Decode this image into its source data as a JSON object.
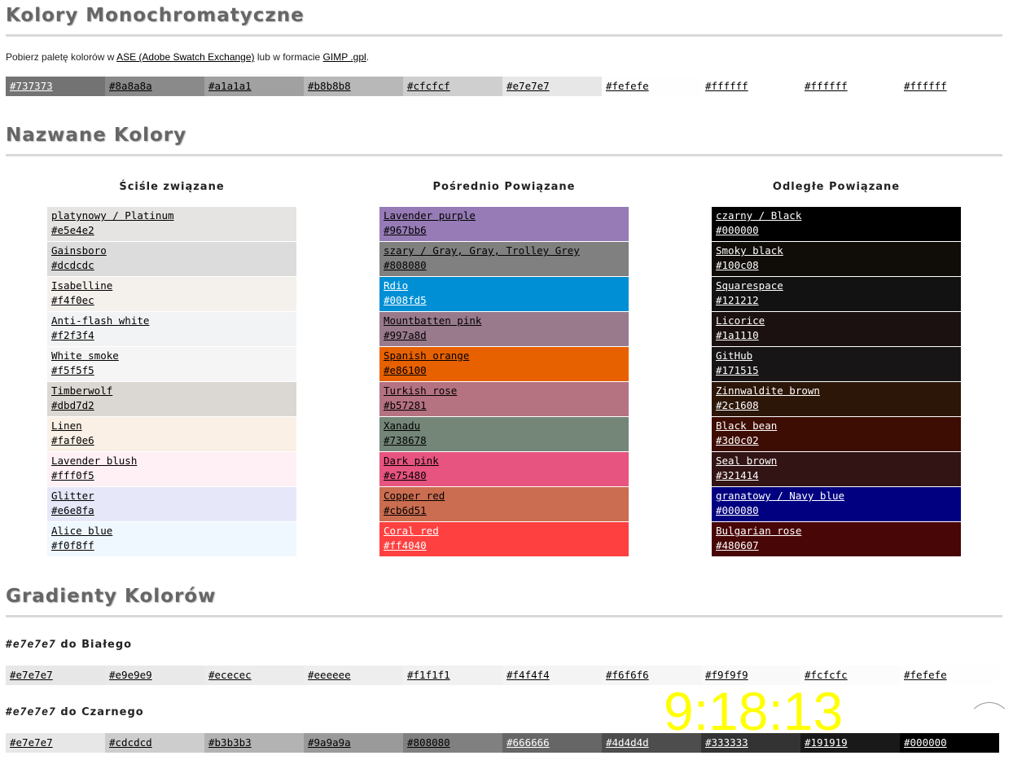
{
  "mono": {
    "title": "Kolory Monochromatyczne",
    "intro_prefix": "Pobierz paletę kolorów w ",
    "ase_link": "ASE (Adobe Swatch Exchange)",
    "intro_mid": " lub w formacie ",
    "gimp_link": "GIMP .gpl",
    "intro_suffix": ".",
    "swatches": [
      {
        "label": "#737373",
        "bg": "#737373",
        "fg": "#ffffff"
      },
      {
        "label": "#8a8a8a",
        "bg": "#8a8a8a",
        "fg": "#000000"
      },
      {
        "label": "#a1a1a1",
        "bg": "#a1a1a1",
        "fg": "#000000"
      },
      {
        "label": "#b8b8b8",
        "bg": "#b8b8b8",
        "fg": "#000000"
      },
      {
        "label": "#cfcfcf",
        "bg": "#cfcfcf",
        "fg": "#000000"
      },
      {
        "label": "#e7e7e7",
        "bg": "#e7e7e7",
        "fg": "#000000"
      },
      {
        "label": "#fefefe",
        "bg": "#fefefe",
        "fg": "#000000"
      },
      {
        "label": "#ffffff",
        "bg": "#ffffff",
        "fg": "#000000"
      },
      {
        "label": "#ffffff",
        "bg": "#ffffff",
        "fg": "#000000"
      },
      {
        "label": "#ffffff",
        "bg": "#ffffff",
        "fg": "#000000"
      }
    ]
  },
  "named": {
    "title": "Nazwane Kolory",
    "columns": [
      {
        "title": "Ściśle związane",
        "items": [
          {
            "name": "platynowy / Platinum",
            "hex": "#e5e4e2",
            "bg": "#e5e4e2",
            "fg": "#000000"
          },
          {
            "name": "Gainsboro",
            "hex": "#dcdcdc",
            "bg": "#dcdcdc",
            "fg": "#000000"
          },
          {
            "name": "Isabelline",
            "hex": "#f4f0ec",
            "bg": "#f4f0ec",
            "fg": "#000000"
          },
          {
            "name": "Anti-flash white",
            "hex": "#f2f3f4",
            "bg": "#f2f3f4",
            "fg": "#000000"
          },
          {
            "name": "White smoke",
            "hex": "#f5f5f5",
            "bg": "#f5f5f5",
            "fg": "#000000"
          },
          {
            "name": "Timberwolf",
            "hex": "#dbd7d2",
            "bg": "#dbd7d2",
            "fg": "#000000"
          },
          {
            "name": "Linen",
            "hex": "#faf0e6",
            "bg": "#faf0e6",
            "fg": "#000000"
          },
          {
            "name": "Lavender blush",
            "hex": "#fff0f5",
            "bg": "#fff0f5",
            "fg": "#000000"
          },
          {
            "name": "Glitter",
            "hex": "#e6e8fa",
            "bg": "#e6e8fa",
            "fg": "#000000"
          },
          {
            "name": "Alice blue",
            "hex": "#f0f8ff",
            "bg": "#f0f8ff",
            "fg": "#000000"
          }
        ]
      },
      {
        "title": "Pośrednio Powiązane",
        "items": [
          {
            "name": "Lavender purple",
            "hex": "#967bb6",
            "bg": "#967bb6",
            "fg": "#000000"
          },
          {
            "name": "szary / Gray, Gray, Trolley Grey",
            "hex": "#808080",
            "bg": "#808080",
            "fg": "#000000"
          },
          {
            "name": "Rdio",
            "hex": "#008fd5",
            "bg": "#008fd5",
            "fg": "#ffffff"
          },
          {
            "name": "Mountbatten pink",
            "hex": "#997a8d",
            "bg": "#997a8d",
            "fg": "#000000"
          },
          {
            "name": "Spanish orange",
            "hex": "#e86100",
            "bg": "#e86100",
            "fg": "#000000"
          },
          {
            "name": "Turkish rose",
            "hex": "#b57281",
            "bg": "#b57281",
            "fg": "#000000"
          },
          {
            "name": "Xanadu",
            "hex": "#738678",
            "bg": "#738678",
            "fg": "#000000"
          },
          {
            "name": "Dark pink",
            "hex": "#e75480",
            "bg": "#e75480",
            "fg": "#000000"
          },
          {
            "name": "Copper red",
            "hex": "#cb6d51",
            "bg": "#cb6d51",
            "fg": "#000000"
          },
          {
            "name": "Coral red",
            "hex": "#ff4040",
            "bg": "#ff4040",
            "fg": "#ffffff"
          }
        ]
      },
      {
        "title": "Odległe Powiązane",
        "items": [
          {
            "name": "czarny / Black",
            "hex": "#000000",
            "bg": "#000000",
            "fg": "#ffffff"
          },
          {
            "name": "Smoky black",
            "hex": "#100c08",
            "bg": "#100c08",
            "fg": "#ffffff"
          },
          {
            "name": "Squarespace",
            "hex": "#121212",
            "bg": "#121212",
            "fg": "#ffffff"
          },
          {
            "name": "Licorice",
            "hex": "#1a1110",
            "bg": "#1a1110",
            "fg": "#ffffff"
          },
          {
            "name": "GitHub",
            "hex": "#171515",
            "bg": "#171515",
            "fg": "#ffffff"
          },
          {
            "name": "Zinnwaldite brown",
            "hex": "#2c1608",
            "bg": "#2c1608",
            "fg": "#ffffff"
          },
          {
            "name": "Black bean",
            "hex": "#3d0c02",
            "bg": "#3d0c02",
            "fg": "#ffffff"
          },
          {
            "name": "Seal brown",
            "hex": "#321414",
            "bg": "#321414",
            "fg": "#ffffff"
          },
          {
            "name": "granatowy / Navy blue",
            "hex": "#000080",
            "bg": "#000080",
            "fg": "#ffffff"
          },
          {
            "name": "Bulgarian rose",
            "hex": "#480607",
            "bg": "#480607",
            "fg": "#ffffff"
          }
        ]
      }
    ]
  },
  "gradients": {
    "title": "Gradienty Kolorów",
    "to_white": {
      "hex": "#e7e7e7",
      "text": " do Białego",
      "swatches": [
        {
          "label": "#e7e7e7",
          "bg": "#e7e7e7",
          "fg": "#000000"
        },
        {
          "label": "#e9e9e9",
          "bg": "#e9e9e9",
          "fg": "#000000"
        },
        {
          "label": "#ececec",
          "bg": "#ececec",
          "fg": "#000000"
        },
        {
          "label": "#eeeeee",
          "bg": "#eeeeee",
          "fg": "#000000"
        },
        {
          "label": "#f1f1f1",
          "bg": "#f1f1f1",
          "fg": "#000000"
        },
        {
          "label": "#f4f4f4",
          "bg": "#f4f4f4",
          "fg": "#000000"
        },
        {
          "label": "#f6f6f6",
          "bg": "#f6f6f6",
          "fg": "#000000"
        },
        {
          "label": "#f9f9f9",
          "bg": "#f9f9f9",
          "fg": "#000000"
        },
        {
          "label": "#fcfcfc",
          "bg": "#fcfcfc",
          "fg": "#000000"
        },
        {
          "label": "#fefefe",
          "bg": "#fefefe",
          "fg": "#000000"
        }
      ]
    },
    "to_black": {
      "hex": "#e7e7e7",
      "text": " do Czarnego",
      "swatches": [
        {
          "label": "#e7e7e7",
          "bg": "#e7e7e7",
          "fg": "#000000"
        },
        {
          "label": "#cdcdcd",
          "bg": "#cdcdcd",
          "fg": "#000000"
        },
        {
          "label": "#b3b3b3",
          "bg": "#b3b3b3",
          "fg": "#000000"
        },
        {
          "label": "#9a9a9a",
          "bg": "#9a9a9a",
          "fg": "#000000"
        },
        {
          "label": "#808080",
          "bg": "#808080",
          "fg": "#000000"
        },
        {
          "label": "#666666",
          "bg": "#666666",
          "fg": "#ffffff"
        },
        {
          "label": "#4d4d4d",
          "bg": "#4d4d4d",
          "fg": "#ffffff"
        },
        {
          "label": "#333333",
          "bg": "#333333",
          "fg": "#ffffff"
        },
        {
          "label": "#191919",
          "bg": "#191919",
          "fg": "#ffffff"
        },
        {
          "label": "#000000",
          "bg": "#000000",
          "fg": "#ffffff"
        }
      ]
    }
  },
  "clock": {
    "time": "9:18:13",
    "color": "#ffff00"
  }
}
